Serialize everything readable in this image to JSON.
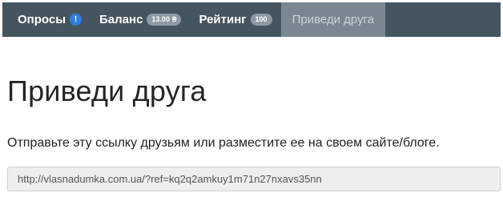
{
  "navbar": {
    "surveys": {
      "label": "Опросы",
      "badge": "!"
    },
    "balance": {
      "label": "Баланс",
      "badge": "13.00 ₴"
    },
    "rating": {
      "label": "Рейтинг",
      "badge": "100"
    },
    "invite": {
      "label": "Приведи друга",
      "active": true
    }
  },
  "main": {
    "title": "Приведи друга",
    "instructions": "Отправьте эту ссылку друзьям или разместите ее на своем сайте/блоге.",
    "referral_link": "http://vlasnadumka.com.ua/?ref=kq2q2amkuy1m71n27nxavs35nn"
  },
  "colors": {
    "navbar_bg": "#455560",
    "active_tab_bg": "#7b8790",
    "alert_badge": "#2d7fe0",
    "pill_badge": "#8e9aa3"
  },
  "icons": {
    "surveys_badge": "exclamation-circle-icon"
  }
}
